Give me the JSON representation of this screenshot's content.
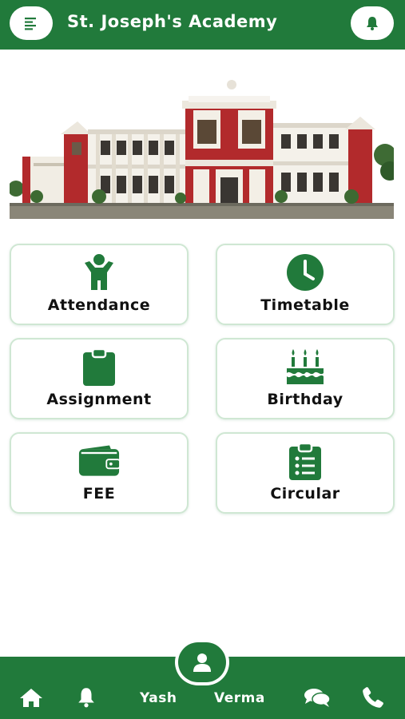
{
  "header": {
    "title": "St. Joseph's Academy",
    "menu_icon": "menu-icon",
    "bell_icon": "bell-icon"
  },
  "banner": {
    "icon": "school-building-image"
  },
  "tiles": [
    {
      "label": "Attendance",
      "icon": "person-icon"
    },
    {
      "label": "Timetable",
      "icon": "clock-icon"
    },
    {
      "label": "Assignment",
      "icon": "clipboard-icon"
    },
    {
      "label": "Birthday",
      "icon": "birthday-cake-icon"
    },
    {
      "label": "FEE",
      "icon": "wallet-icon"
    },
    {
      "label": "Circular",
      "icon": "list-clipboard-icon"
    }
  ],
  "bottom_nav": {
    "first_name": "Yash",
    "last_name": "Verma",
    "icons": [
      "home-icon",
      "bell-icon",
      "user-icon",
      "chat-icon",
      "phone-icon"
    ]
  },
  "colors": {
    "primary": "#217a3b",
    "tile_border": "#cfe7d3"
  }
}
